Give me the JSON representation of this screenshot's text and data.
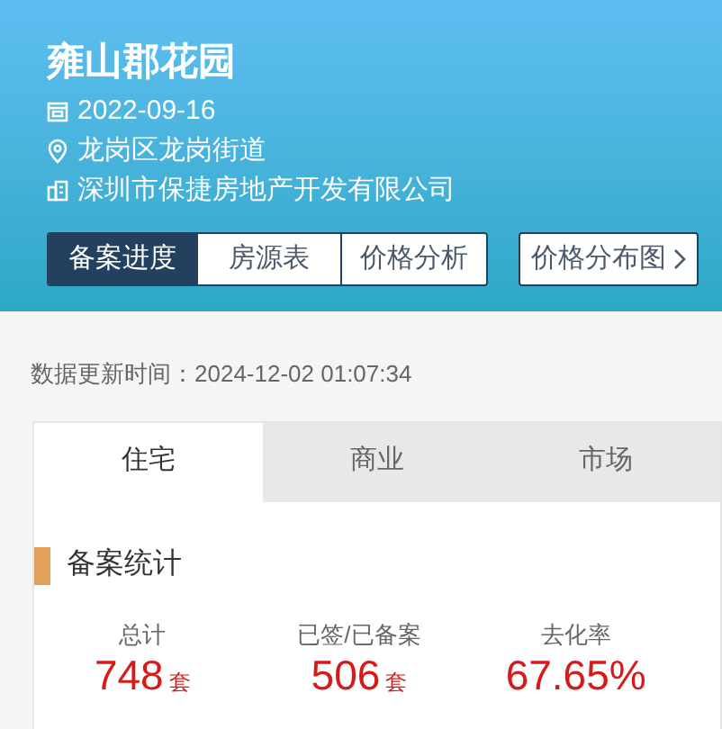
{
  "project": {
    "name": "雍山郡花园",
    "date": "2022-09-16",
    "district": "龙岗区龙岗街道",
    "developer": "深圳市保捷房地产开发有限公司"
  },
  "nav_tabs": [
    {
      "label": "备案进度",
      "selected": true
    },
    {
      "label": "房源表",
      "selected": false
    },
    {
      "label": "价格分析",
      "selected": false
    }
  ],
  "price_map_link": {
    "label": "价格分布图"
  },
  "update_time": "数据更新时间：2024-12-02 01:07:34",
  "category_tabs": [
    {
      "label": "住宅",
      "selected": true
    },
    {
      "label": "商业",
      "selected": false
    },
    {
      "label": "市场",
      "selected": false
    }
  ],
  "section_title": "备案统计",
  "stats": [
    {
      "label": "总计",
      "value": "748",
      "unit": "套"
    },
    {
      "label": "已签/已备案",
      "value": "506",
      "unit": "套"
    },
    {
      "label": "去化率",
      "value": "67.65%"
    }
  ]
}
